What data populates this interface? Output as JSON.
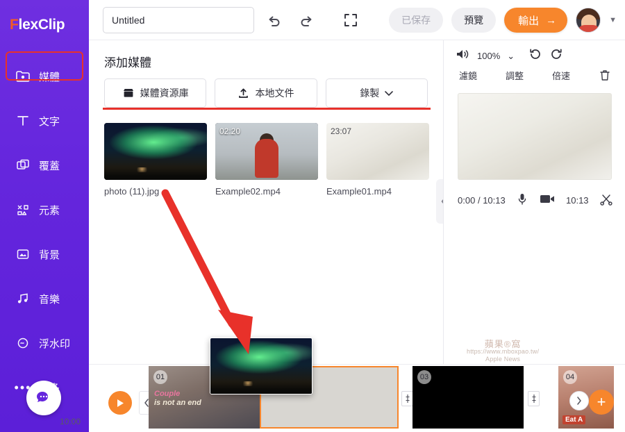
{
  "app": {
    "brand_primary": "#f05a28",
    "accent": "#f7862c",
    "highlight": "#e8312a",
    "sidebar_gradient_from": "#6f2fe0",
    "sidebar_gradient_to": "#5c1fd8",
    "logo_text": "FlexClip",
    "logo_prefix": "F",
    "logo_suffix": "lexClip"
  },
  "sidebar": {
    "items": [
      {
        "label": "媒體",
        "icon": "media-folder-icon",
        "active": true
      },
      {
        "label": "文字",
        "icon": "text-icon",
        "active": false
      },
      {
        "label": "覆蓋",
        "icon": "overlay-icon",
        "active": false
      },
      {
        "label": "元素",
        "icon": "elements-icon",
        "active": false
      },
      {
        "label": "背景",
        "icon": "background-icon",
        "active": false
      },
      {
        "label": "音樂",
        "icon": "music-icon",
        "active": false
      },
      {
        "label": "浮水印",
        "icon": "watermark-icon",
        "active": false
      },
      {
        "label": "更多",
        "icon": "more-dots-icon",
        "active": false
      }
    ],
    "chat_icon": "chat-bubble-icon"
  },
  "topbar": {
    "project_title": "Untitled",
    "project_title_placeholder": "Untitled",
    "undo_icon": "undo-icon",
    "redo_icon": "redo-icon",
    "fullscreen_icon": "fullscreen-icon",
    "saved_label": "已保存",
    "preview_label": "預覽",
    "export_label": "輸出",
    "export_arrow": "→",
    "avatar": "user-avatar",
    "avatar_caret": "▼"
  },
  "media": {
    "title": "添加媒體",
    "tabs": [
      {
        "label": "媒體資源庫",
        "icon": "store-icon"
      },
      {
        "label": "本地文件",
        "icon": "upload-icon"
      },
      {
        "label": "錄製",
        "icon": "chevron-down-icon"
      }
    ],
    "items": [
      {
        "name": "photo (11).jpg",
        "duration": "",
        "kind": "image-aurora"
      },
      {
        "name": "Example02.mp4",
        "duration": "02:20",
        "kind": "video-person"
      },
      {
        "name": "Example01.mp4",
        "duration": "23:07",
        "kind": "video-light"
      }
    ],
    "collapse_icon": "chevron-left-icon"
  },
  "preview": {
    "volume_icon": "speaker-icon",
    "zoom_level": "100%",
    "zoom_caret": "⌄",
    "undo_icon": "undo-circle-icon",
    "redo_icon": "redo-circle-icon",
    "tools": [
      {
        "label": "濾鏡",
        "icon": "filter-icon"
      },
      {
        "label": "調整",
        "icon": "adjust-icon"
      },
      {
        "label": "倍速",
        "icon": "speed-icon"
      },
      {
        "label": "",
        "icon": "trash-icon"
      }
    ],
    "current_time": "0:00",
    "total_time": "10:13",
    "time_separator": "/",
    "mic_icon": "microphone-icon",
    "media-icon": "media-clip-icon",
    "duration_right": "10:13",
    "scissors_icon": "scissors-icon",
    "watermark_line1": "蘋果®窩",
    "watermark_line2": "https://www.mboxpao.tw/",
    "watermark_line3": "Apple News"
  },
  "timeline": {
    "play_icon": "play-icon",
    "prev_icon": "chevron-left-icon",
    "next_icon": "chevron-right-icon",
    "add_icon": "plus-icon",
    "split_icon": "split-icon",
    "start_time": "10:00",
    "clips": [
      {
        "number": "01",
        "caption_line1": "Couple",
        "caption_line2": "is not an end"
      },
      {
        "number": "",
        "caption_line1": "",
        "caption_line2": "",
        "selected": true
      },
      {
        "number": "03",
        "caption_line1": "",
        "caption_line2": ""
      },
      {
        "number": "04",
        "caption_line1": "Eat A",
        "caption_line2": ""
      }
    ]
  },
  "annotation": {
    "arrow_color": "#e8312a",
    "drag_thumb_alt": "dragged-aurora-thumbnail"
  }
}
